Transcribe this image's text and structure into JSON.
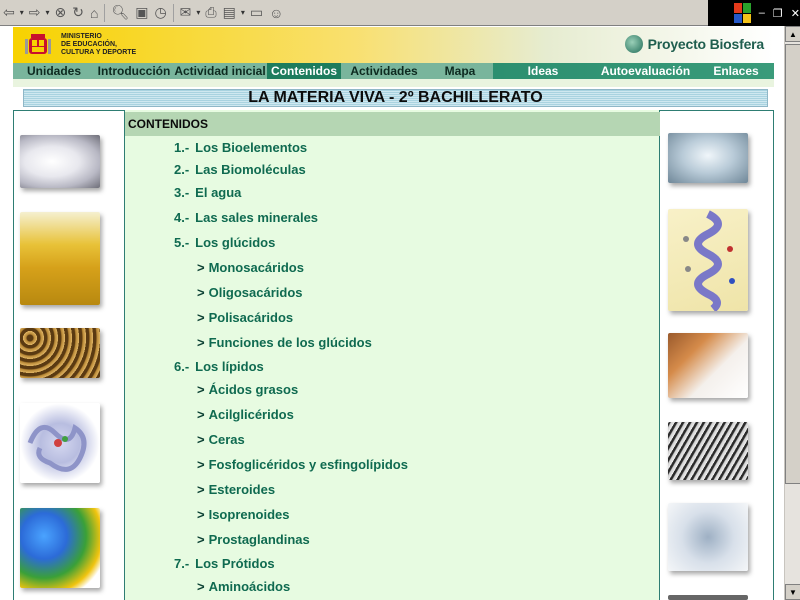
{
  "browser": {
    "back_icon": "back-arrow-icon",
    "forward_icon": "forward-arrow-icon",
    "dropdown_glyph": "▾",
    "stop_icon": "stop-icon",
    "refresh_icon": "refresh-icon",
    "home_icon": "home-icon",
    "search_icon": "search-icon",
    "favorites_icon": "favorites-icon",
    "history_icon": "history-icon",
    "mail_icon": "mail-icon",
    "print_icon": "print-icon",
    "edit_icon": "edit-icon",
    "discuss_icon": "discuss-icon",
    "messenger_icon": "messenger-icon"
  },
  "header": {
    "ministry_line1": "MINISTERIO",
    "ministry_line2": "DE EDUCACIÓN,",
    "ministry_line3": "CULTURA Y DEPORTE",
    "brand": "Proyecto Biosfera"
  },
  "nav": {
    "items_left": [
      {
        "label": "Unidades"
      },
      {
        "label": "Introducción"
      },
      {
        "label": "Actividad inicial"
      },
      {
        "label": "Contenidos",
        "active": true
      },
      {
        "label": "Actividades"
      },
      {
        "label": "Mapa"
      }
    ],
    "items_right": [
      {
        "label": "Ideas"
      },
      {
        "label": "Autoevaluación"
      },
      {
        "label": "Enlaces"
      }
    ]
  },
  "page": {
    "title": "LA MATERIA VIVA - 2º BACHILLERATO",
    "section_header": "CONTENIDOS"
  },
  "contents": {
    "items": [
      {
        "num": "1.-",
        "label": "Los Bioelementos"
      },
      {
        "num": "2.-",
        "label": "Las Biomoléculas"
      },
      {
        "num": "3.-",
        "label": "El agua"
      },
      {
        "num": "4.-",
        "label": "Las sales minerales"
      },
      {
        "num": "5.-",
        "label": "Los glúcidos"
      },
      {
        "num": "6.-",
        "label": "Los lípidos"
      },
      {
        "num": "7.-",
        "label": "Los Prótidos"
      }
    ],
    "sub_glucidos": [
      {
        "label": "Monosacáridos"
      },
      {
        "label": "Oligosacáridos"
      },
      {
        "label": "Polisacáridos"
      },
      {
        "label": "Funciones de los glúcidos"
      }
    ],
    "sub_lipidos": [
      {
        "label": "Ácidos grasos"
      },
      {
        "label": "Acilglicéridos"
      },
      {
        "label": "Ceras"
      },
      {
        "label": "Fosfoglicéridos y esfingolípidos"
      },
      {
        "label": "Esteroides"
      },
      {
        "label": "Isoprenoides"
      },
      {
        "label": "Prostaglandinas"
      }
    ],
    "sub_protidos": [
      {
        "label": "Aminoácidos"
      }
    ],
    "arrow_glyph": ">"
  },
  "colors": {
    "accent": "#1d7c5d",
    "link": "#0f6a50",
    "content_bg": "#e7fbe1"
  }
}
